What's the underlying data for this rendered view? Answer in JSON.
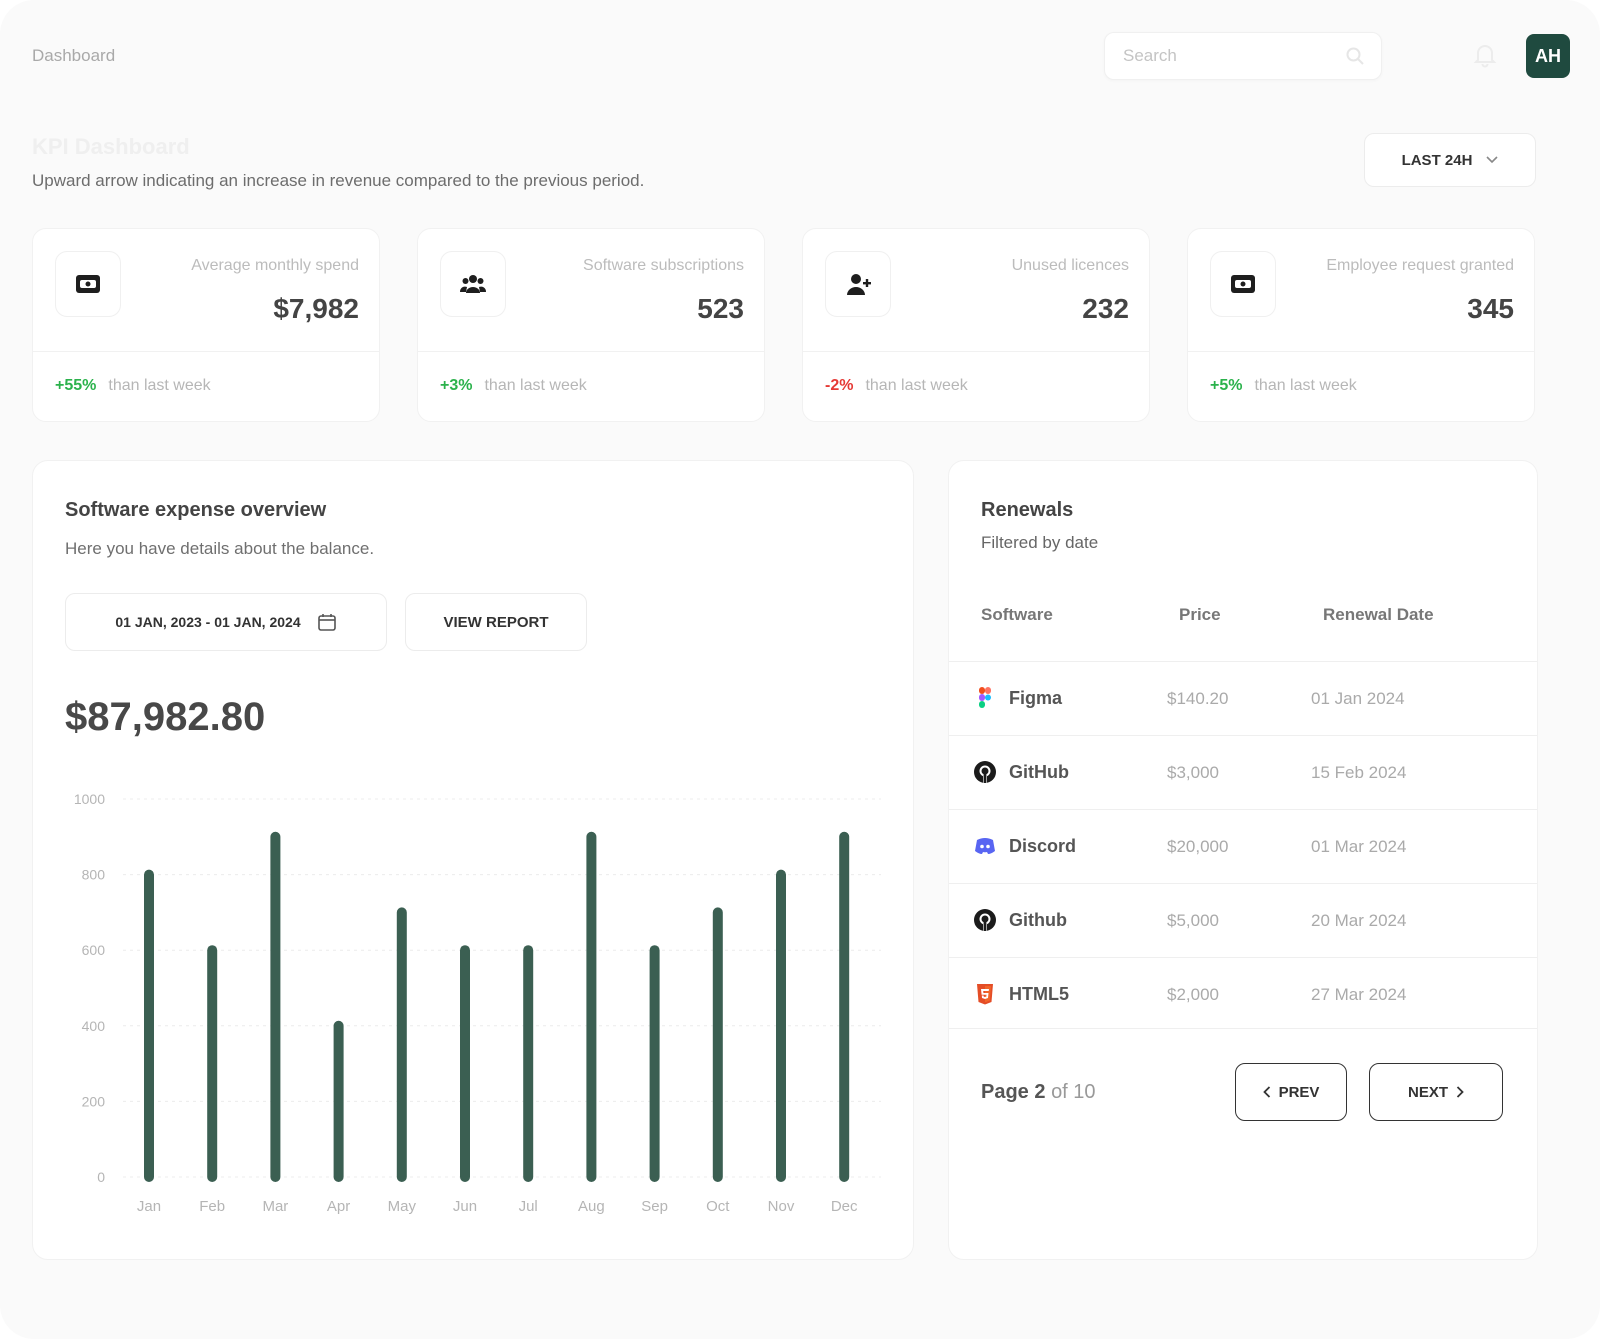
{
  "topbar": {
    "breadcrumb": "Dashboard",
    "search_placeholder": "Search",
    "avatar_initials": "AH"
  },
  "header": {
    "title": "KPI Dashboard",
    "subtitle": "Upward arrow indicating an increase in revenue compared to the previous period.",
    "range_label": "LAST 24H"
  },
  "kpis": [
    {
      "label": "Average monthly spend",
      "value": "$7,982",
      "delta": "+55%",
      "delta_color": "#2bb24c",
      "note": "than last week",
      "icon": "wallet-icon"
    },
    {
      "label": "Software subscriptions",
      "value": "523",
      "delta": "+3%",
      "delta_color": "#2bb24c",
      "note": "than last week",
      "icon": "users-icon"
    },
    {
      "label": "Unused licences",
      "value": "232",
      "delta": "-2%",
      "delta_color": "#e53935",
      "note": "than last week",
      "icon": "user-add-icon"
    },
    {
      "label": "Employee request granted",
      "value": "345",
      "delta": "+5%",
      "delta_color": "#2bb24c",
      "note": "than last week",
      "icon": "wallet-icon"
    }
  ],
  "expense": {
    "title": "Software expense overview",
    "subtitle": "Here you have details about the balance.",
    "date_range": "01 JAN, 2023 - 01 JAN, 2024",
    "report_label": "VIEW REPORT",
    "total": "$87,982.80"
  },
  "chart_data": {
    "type": "bar",
    "categories": [
      "Jan",
      "Feb",
      "Mar",
      "Apr",
      "May",
      "Jun",
      "Jul",
      "Aug",
      "Sep",
      "Oct",
      "Nov",
      "Dec"
    ],
    "values": [
      800,
      600,
      900,
      400,
      700,
      600,
      600,
      900,
      600,
      700,
      800,
      900
    ],
    "yticks": [
      "1000",
      "800",
      "600",
      "400",
      "200",
      "0"
    ],
    "ylim": [
      0,
      1000
    ],
    "grid": true,
    "bar_color": "#3b5f52",
    "title": "",
    "xlabel": "",
    "ylabel": ""
  },
  "renewals": {
    "title": "Renewals",
    "subtitle": "Filtered by date",
    "columns": [
      "Software",
      "Price",
      "Renewal Date"
    ],
    "rows": [
      {
        "name": "Figma",
        "price": "$140.20",
        "date": "01 Jan 2024",
        "icon": "figma-icon"
      },
      {
        "name": "GitHub",
        "price": "$3,000",
        "date": "15 Feb 2024",
        "icon": "github-icon"
      },
      {
        "name": "Discord",
        "price": "$20,000",
        "date": "01 Mar 2024",
        "icon": "discord-icon"
      },
      {
        "name": "Github",
        "price": "$5,000",
        "date": "20 Mar 2024",
        "icon": "github-icon"
      },
      {
        "name": "HTML5",
        "price": "$2,000",
        "date": "27 Mar 2024",
        "icon": "html5-icon"
      }
    ],
    "pager": {
      "prefix": "Page",
      "current": "2",
      "of": "of 10",
      "prev": "PREV",
      "next": "NEXT"
    }
  }
}
